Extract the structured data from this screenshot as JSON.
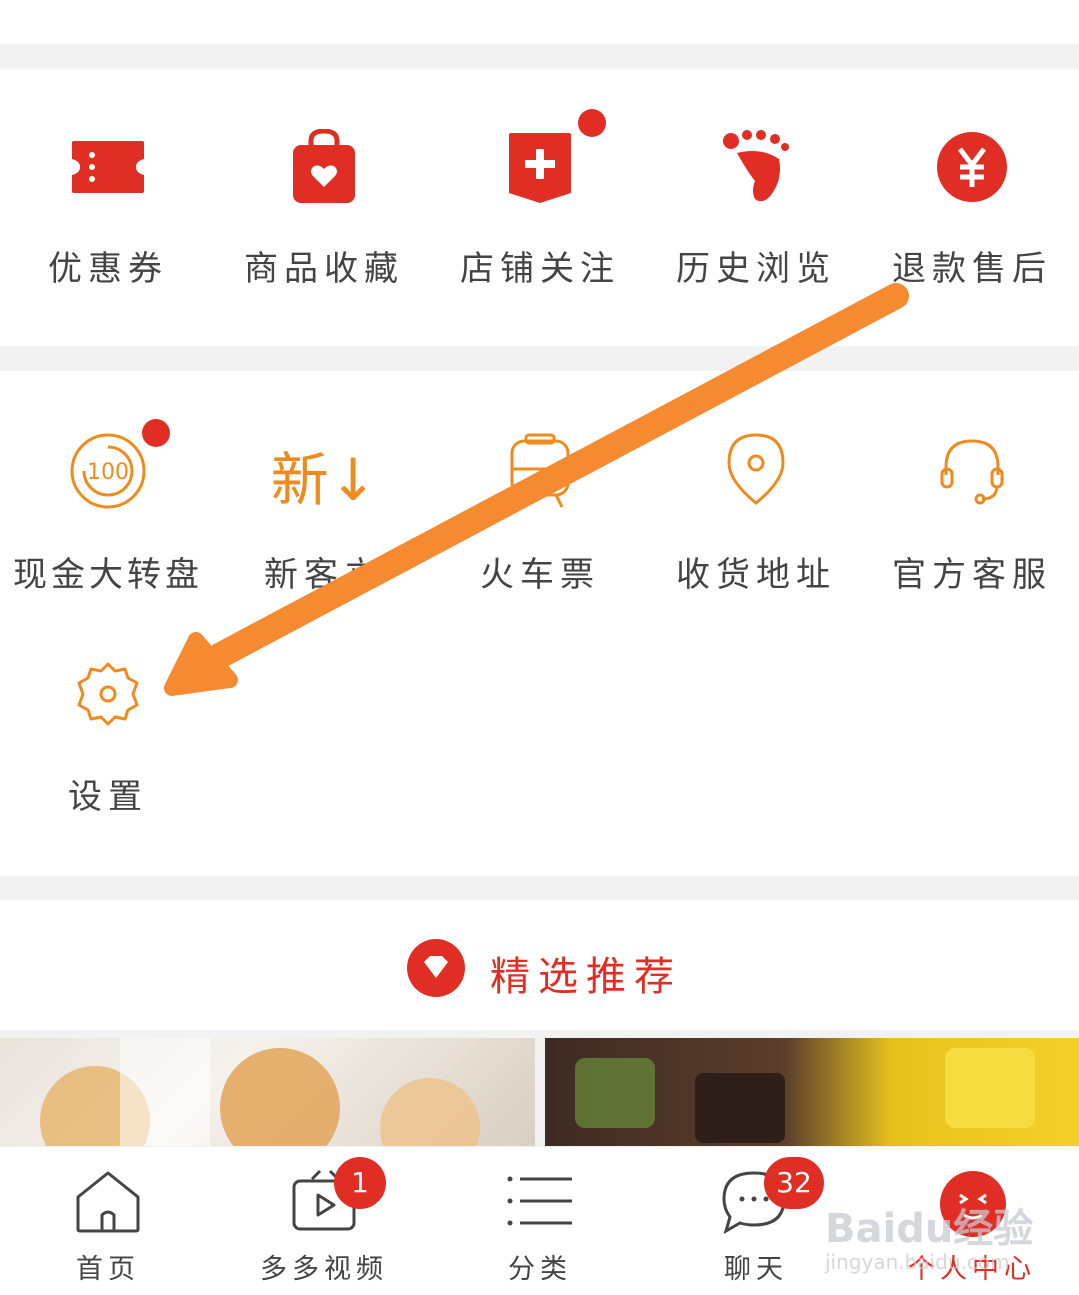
{
  "shortcuts_row1": [
    {
      "label": "优惠券",
      "icon": "coupon-icon"
    },
    {
      "label": "商品收藏",
      "icon": "shopping-bag-heart-icon"
    },
    {
      "label": "店铺关注",
      "icon": "shop-plus-icon"
    },
    {
      "label": "历史浏览",
      "icon": "footprint-icon"
    },
    {
      "label": "退款售后",
      "icon": "yen-circle-icon"
    }
  ],
  "services_row": [
    {
      "label": "现金大转盘",
      "icon": "cash-wheel-icon",
      "badge_text": "100"
    },
    {
      "label": "新客立",
      "icon": "new-customer-icon",
      "glyph": "新↓"
    },
    {
      "label": "火车票",
      "icon": "train-ticket-icon"
    },
    {
      "label": "收货地址",
      "icon": "location-pin-icon"
    },
    {
      "label": "官方客服",
      "icon": "headset-icon"
    }
  ],
  "settings": {
    "label": "设置",
    "icon": "gear-icon"
  },
  "recommend": {
    "title": "精选推荐",
    "icon": "diamond-icon"
  },
  "tabbar": [
    {
      "label": "首页",
      "icon": "home-icon"
    },
    {
      "label": "多多视频",
      "icon": "video-icon",
      "badge": "1"
    },
    {
      "label": "分类",
      "icon": "category-list-icon"
    },
    {
      "label": "聊天",
      "icon": "chat-bubble-icon",
      "badge": "32"
    },
    {
      "label": "个人中心",
      "icon": "profile-face-icon",
      "active": true
    }
  ],
  "watermark": {
    "brand": "Baidu经验",
    "url": "jingyan.baidu.com"
  },
  "colors": {
    "accent": "#e02e24",
    "orange": "#f08a1c",
    "arrow": "#f58a30",
    "text": "#444444"
  }
}
